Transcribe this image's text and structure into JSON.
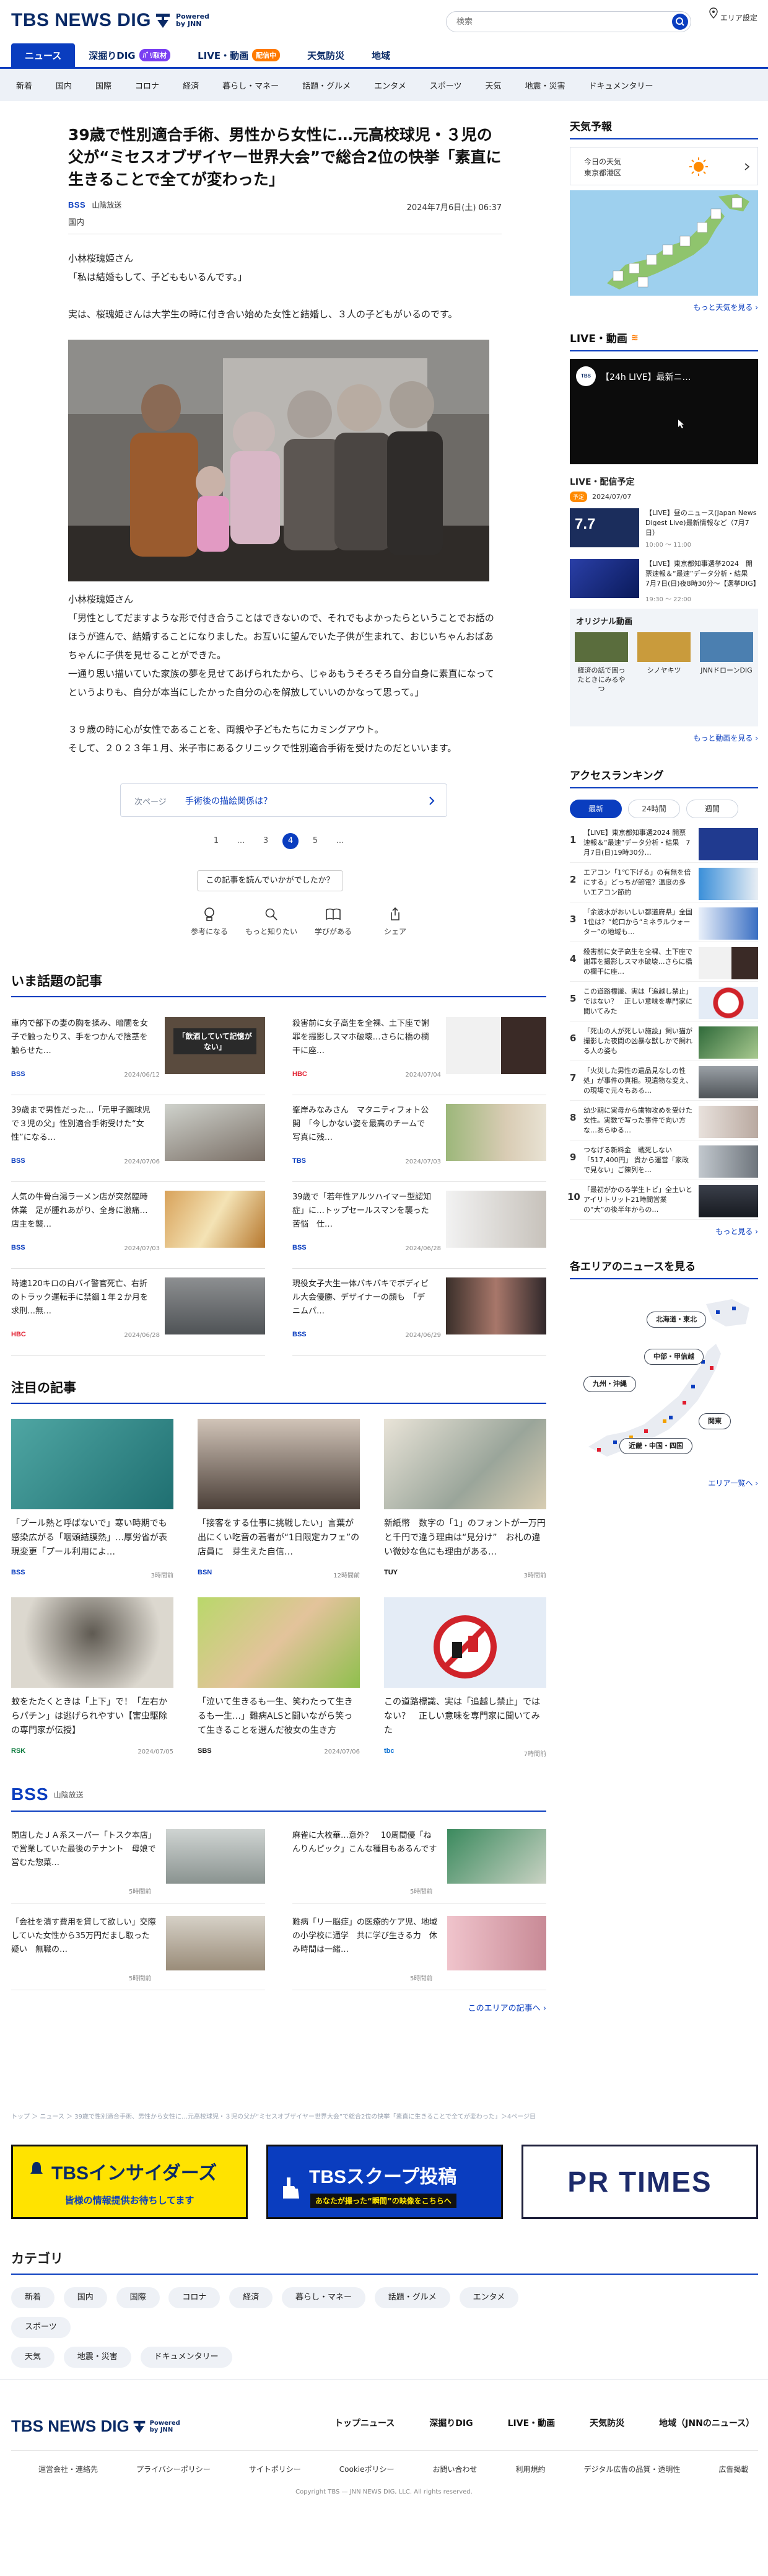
{
  "header": {
    "logo_text": "TBS NEWS DIG",
    "powered": "Powered",
    "powered_by": "by JNN",
    "search_placeholder": "検索",
    "area_label": "エリア設定"
  },
  "tabs": [
    {
      "label": "ニュース",
      "badge": ""
    },
    {
      "label": "深掘りDIG",
      "badge": "ﾊﾞﾘ取材",
      "badge_color": "#7a3ff2"
    },
    {
      "label": "LIVE・動画",
      "badge": "配信中",
      "badge_color": "#ff7a00"
    },
    {
      "label": "天気防災",
      "badge": ""
    },
    {
      "label": "地域",
      "badge": ""
    }
  ],
  "subnav": [
    "新着",
    "国内",
    "国際",
    "コロナ",
    "経済",
    "暮らし・マネー",
    "話題・グルメ",
    "エンタメ",
    "スポーツ",
    "天気",
    "地震・災害",
    "ドキュメンタリー"
  ],
  "article": {
    "title": "39歳で性別適合手術、男性から女性に…元高校球児・３児の父が“ミセスオブザイヤー世界大会”で総合2位の快挙「素直に生きることで全てが変わった」",
    "source": "BSS",
    "source_name": "山陰放送",
    "date": "2024年7月6日(土) 06:37",
    "category": "国内",
    "paragraphs": [
      "小林桜瑰姫さん",
      "「私は結婚もして、子どももいるんです。」",
      "実は、桜瑰姫さんは大学生の時に付き合い始めた女性と結婚し、３人の子どもがいるのです。"
    ],
    "photo_caption": "小林桜瑰姫さん",
    "paragraphs2": [
      "「男性としてだますような形で付き合うことはできないので、それでもよかったらということでお話のほうが進んで、結婚することになりました。お互いに望んでいた子供が生まれて、おじいちゃんおばあちゃんに子供を見せることができた。",
      "一通り思い描いていた家族の夢を見せてあげられたから、じゃあもうそろそろ自分自身に素直になってというよりも、自分が本当にしたかった自分の心を解放していいのかなって思って。」"
    ],
    "paragraphs3": [
      "３９歳の時に心が女性であることを、両親や子どもたちにカミングアウト。",
      "そして、２０２３年１月、米子市にあるクリニックで性別適合手術を受けたのだといいます。"
    ],
    "next_label": "次ページ",
    "next_title": "手術後の描絵関係は？",
    "pages": [
      "1",
      "…",
      "3",
      "4",
      "5",
      "…"
    ],
    "current_page": "4",
    "feedback_q": "この記事を読んでいかがでしたか？",
    "reactions": [
      "参考になる",
      "もっと知りたい",
      "学びがある",
      "シェア"
    ]
  },
  "hot": {
    "heading": "いま話題の記事",
    "items": [
      {
        "title": "車内で部下の妻の胸を揉み、暗闇を女子で触ったりス、手をつかんで陰茎を触らせた…",
        "src": "BSS",
        "src_color": "#0a3dbf",
        "date": "2024/06/12",
        "thumb_text": "「飲酒していて記憶がない」"
      },
      {
        "title": "殺害前に女子高生を全裸、土下座で謝罪を撮影しスマホ破壊…さらに橋の欄干に座…",
        "src": "HBC",
        "src_color": "#e11d2e",
        "date": "2024/07/04",
        "thumb_text": ""
      },
      {
        "title": "39歳まで男性だった…「元甲子園球児で３児の父」性別適合手術受けた“女性”になる…",
        "src": "BSS",
        "src_color": "#0a3dbf",
        "date": "2024/07/06",
        "thumb_text": ""
      },
      {
        "title": "峯岸みなみさん　マタニティフォト公開　「今しかない姿を最高のチームで写真に残…",
        "src": "TBS",
        "src_color": "#0a3dbf",
        "date": "2024/07/03",
        "thumb_text": ""
      },
      {
        "title": "人気の牛骨白湯ラーメン店が突然臨時休業　足が腫れあがり、全身に激痛…店主を襲…",
        "src": "BSS",
        "src_color": "#0a3dbf",
        "date": "2024/07/03",
        "thumb_text": ""
      },
      {
        "title": "39歳で「若年性アルツハイマー型認知症」に…トップセールスマンを襲った苦悩　仕…",
        "src": "BSS",
        "src_color": "#0a3dbf",
        "date": "2024/06/28",
        "thumb_text": ""
      },
      {
        "title": "時速120キロの白バイ警官死亡、右折のトラック運転手に禁錮１年２か月を求刑…無…",
        "src": "HBC",
        "src_color": "#e11d2e",
        "date": "2024/06/28",
        "thumb_text": ""
      },
      {
        "title": "現役女子大生一体パキパキでボディビル大会優勝、デザイナーの顔も　「デニムパ…",
        "src": "BSS",
        "src_color": "#0a3dbf",
        "date": "2024/06/29",
        "thumb_text": ""
      }
    ]
  },
  "featured": {
    "heading": "注目の記事",
    "items": [
      {
        "title": "「プール熱と呼ばないで」寒い時期でも感染広がる「咽頭結膜熱」…厚労省が表現変更「プール利用によ…",
        "src": "BSS",
        "src_color": "#0a3dbf",
        "date": "3時間前"
      },
      {
        "title": "「接客をする仕事に挑戦したい」言葉が出にくい吃音の若者が“1日限定カフェ”の店員に　芽生えた自信…",
        "src": "BSN",
        "src_color": "#0a3dbf",
        "date": "12時間前"
      },
      {
        "title": "新紙幣　数字の「1」のフォントが一万円と千円で違う理由は“見分け”　お札の違い微妙な色にも理由がある…",
        "src": "TUY",
        "src_color": "#111111",
        "date": "3時間前"
      },
      {
        "title": "蚊をたたくときは「上下」で！「左右からパチン」は逃げられやすい【害虫駆除の専門家が伝授】",
        "src": "RSK",
        "src_color": "#0a7a3c",
        "date": "2024/07/05"
      },
      {
        "title": "「泣いて生きるも一生、笑わたって生きるも一生…」難病ALSと闘いながら笑って生きることを選んだ彼女の生き方",
        "src": "SBS",
        "src_color": "#111111",
        "date": "2024/07/06"
      },
      {
        "title": "この道路標識、実は「追越し禁止」ではない？　正しい意味を専門家に聞いてみた",
        "src": "tbc",
        "src_color": "#0a6fd1",
        "date": "7時間前"
      }
    ]
  },
  "bss": {
    "logo": "BSS",
    "name": "山陰放送",
    "items": [
      {
        "title": "閉店したＪＡ系スーパー「トスク本店」で営業していた最後のテナント　母娘で営むた惣菜…",
        "date": "5時間前"
      },
      {
        "title": "麻雀に大枚華…意外？　10周間優「ねんりんピック」こんな種目もあるんです",
        "date": "5時間前"
      },
      {
        "title": "「会社を潰す費用を貸して欲しい」交際していた女性から35万円だまし取った疑い　無職の…",
        "date": "5時間前"
      },
      {
        "title": "難病「リー脳症」の医療的ケア児、地域の小学校に通学　共に学び生きる力　休み時間は一緒…",
        "date": "5時間前"
      }
    ],
    "more": "このエリアの記事へ ›"
  },
  "breadcrumb": "トップ ＞ ニュース ＞ 39歳で性別適合手術、男性から女性に…元高校球児・３児の父が“ミセスオブザイヤー世界大会”で総合2位の快挙「素直に生きることで全てが変わった」＞4ページ目",
  "banners": {
    "b1_title": "TBSインサイダーズ",
    "b1_sub": "皆様の情報提供お待ちしてます",
    "b2_title": "TBSスクープ投稿",
    "b2_sub": "あなたが撮った“瞬間”の映像をこちらへ",
    "b3_title": "PR TIMES"
  },
  "categories": {
    "heading": "カテゴリ",
    "items": [
      "新着",
      "国内",
      "国際",
      "コロナ",
      "経済",
      "暮らし・マネー",
      "話題・グルメ",
      "エンタメ",
      "スポーツ",
      "天気",
      "地震・災害",
      "ドキュメンタリー"
    ]
  },
  "footer": {
    "nav": [
      "トップニュース",
      "深掘りDIG",
      "LIVE・動画",
      "天気防災",
      "地域（JNNのニュース）"
    ],
    "links": [
      "運営会社・連絡先",
      "プライバシーポリシー",
      "サイトポリシー",
      "Cookieポリシー",
      "お問い合わせ",
      "利用規約",
      "デジタル広告の品質・透明性",
      "広告掲載"
    ],
    "copyright": "Copyright TBS — JNN NEWS DIG, LLC. All rights reserved."
  },
  "sidebar": {
    "weather_h": "天気予報",
    "weather_today": "今日の天気",
    "weather_area": "東京都港区",
    "weather_more": "もっと天気を見る ›",
    "live_h": "LIVE・動画",
    "live_video_title": "【24h LIVE】最新ニ…",
    "live_chip": "TBS",
    "sched_h": "LIVE・配信予定",
    "sched_badge": "予定",
    "sched_date": "2024/07/07",
    "sched": [
      {
        "text": "【LIVE】昼のニュース(Japan News Digest Live)最新情報など（7月7日）",
        "time": "10:00 〜 11:00",
        "thumb_text": "7.7"
      },
      {
        "text": "【LIVE】東京都知事選挙2024　開票速報＆“最速”データ分析・結果　7月7日(日)夜8時30分〜【選挙DIG】",
        "time": "19:30 〜 22:00",
        "thumb_text": ""
      }
    ],
    "orig_h": "オリジナル動画",
    "orig": [
      "経済の話で困ったときにみるやつ",
      "シノヤキツ",
      "JNNドローンDIG"
    ],
    "live_more": "もっと動画を見る ›",
    "rank_h": "アクセスランキング",
    "rank_tabs": [
      "最新",
      "24時間",
      "週間"
    ],
    "rank": [
      "【LIVE】東京都知事選2024 開票速報＆“最速”データ分析・結果　7月7日(日)19時30分…",
      "エアコン「1℃下げる」の有無を倍にする」どっちが節電？温度の多いエアコン節約",
      "「余波水がおいしい都道府県」全国1位は？“蛇口から“ミネラルウォーター”の地域も…",
      "殺害前に女子高生を全裸、土下座で謝罪を撮影しスマホ破壊…さらに橋の欄干に座…",
      "この道路標識、実は「追越し禁止」ではない？　正しい意味を専門家に聞いてみた",
      "「死山の人が死しい施設」飼い猫が撮影した夜間の凶暴な獣しかで飼れる人の姿も",
      "「火災した男性の遺品見なしの性処」が事件の真相。現遺物な変え、の現場で元々もある…",
      "幼少期に実母から歯物攻めを受けた女性。実数で写った事件で向い方な…あらゆる…",
      "つなげる新料金　戦死しない「517,400円」 貴から運営「家政で見ない」ご陳列を…",
      "「最初がかのる学生トビ」全土いとアイリトリット21時間営業の“大”の後半年からの…"
    ],
    "rank_more": "もっと見る ›",
    "region_h": "各エリアのニュースを見る",
    "regions": [
      "北海道・東北",
      "中部・甲信越",
      "九州・沖縄",
      "関東",
      "近畿・中国・四国"
    ],
    "region_more": "エリア一覧へ ›"
  },
  "colors": {
    "brand": "#0a3dbf",
    "brand_dark": "#0a2a66",
    "live_badge": "#ff7a00",
    "deep_badge": "#7a3ff2"
  }
}
